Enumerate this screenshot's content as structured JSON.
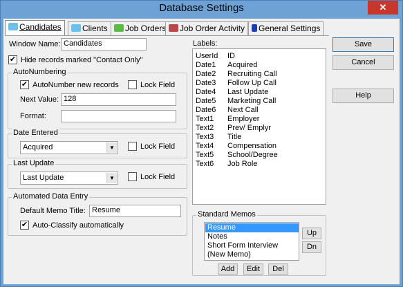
{
  "window": {
    "title": "Database Settings",
    "close": "✕"
  },
  "tabs": [
    {
      "label": "Candidates"
    },
    {
      "label": "Clients"
    },
    {
      "label": "Job Orders"
    },
    {
      "label": "Job Order Activity"
    },
    {
      "label": "General Settings"
    }
  ],
  "form": {
    "window_name_label": "Window Name:",
    "window_name_value": "Candidates",
    "hide_records_label": "Hide records marked \"Contact Only\"",
    "autonumbering": {
      "title": "AutoNumbering",
      "auto_label": "AutoNumber new records",
      "lock_label": "Lock Field",
      "next_value_label": "Next Value:",
      "next_value": "128",
      "format_label": "Format:",
      "format_value": ""
    },
    "date_entered": {
      "title": "Date Entered",
      "value": "Acquired",
      "lock_label": "Lock Field"
    },
    "last_update": {
      "title": "Last Update",
      "value": "Last Update",
      "lock_label": "Lock Field"
    },
    "automated": {
      "title": "Automated Data Entry",
      "memo_label": "Default Memo Title:",
      "memo_value": "Resume",
      "autoclassify_label": "Auto-Classify automatically"
    }
  },
  "labels": {
    "title": "Labels:",
    "rows": [
      {
        "key": "UserId",
        "value": "ID"
      },
      {
        "key": "Date1",
        "value": "Acquired"
      },
      {
        "key": "Date2",
        "value": "Recruiting Call"
      },
      {
        "key": "Date3",
        "value": "Follow Up Call"
      },
      {
        "key": "Date4",
        "value": "Last Update"
      },
      {
        "key": "Date5",
        "value": "Marketing Call"
      },
      {
        "key": "Date6",
        "value": "Next Call"
      },
      {
        "key": "Text1",
        "value": "Employer"
      },
      {
        "key": "Text2",
        "value": "Prev/ Emplyr"
      },
      {
        "key": "Text3",
        "value": "Title"
      },
      {
        "key": "Text4",
        "value": "Compensation"
      },
      {
        "key": "Text5",
        "value": "School/Degree"
      },
      {
        "key": "Text6",
        "value": "Job Role"
      }
    ]
  },
  "memos": {
    "title": "Standard Memos",
    "items": [
      "Resume",
      "Notes",
      "Short Form Interview",
      "(New Memo)"
    ],
    "up": "Up",
    "dn": "Dn",
    "add": "Add",
    "edit": "Edit",
    "del": "Del"
  },
  "buttons": {
    "save": "Save",
    "cancel": "Cancel",
    "help": "Help"
  },
  "colors": {
    "titlebar": "#6fa2d4",
    "close": "#c9372c",
    "selection": "#3399ff"
  }
}
